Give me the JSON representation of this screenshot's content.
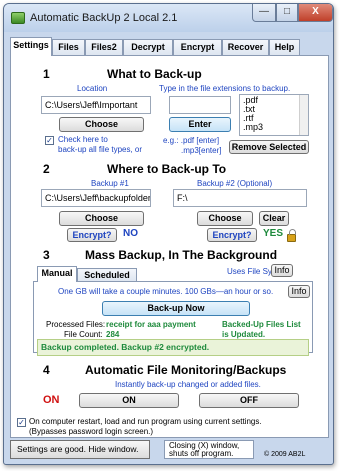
{
  "window": {
    "title": "Automatic BackUp 2 Local 2.1",
    "min_glyph": "—",
    "max_glyph": "□",
    "close_glyph": "X"
  },
  "tabs": [
    "Settings",
    "Files",
    "Files2",
    "Decrypt",
    "Encrypt",
    "Recover",
    "Help"
  ],
  "section1": {
    "num": "1",
    "title": "What to Back-up",
    "location_label": "Location",
    "location_value": "C:\\Users\\Jeff\\Important",
    "choose_label": "Choose",
    "ext_hint": "Type in the file extensions to backup.",
    "ext_input": "",
    "enter_label": "Enter",
    "examples_line1": "e.g.: .pdf [enter]",
    "examples_line2": ".mp3[enter]",
    "extensions": [
      ".pdf",
      ".txt",
      ".rtf",
      ".mp3"
    ],
    "remove_label": "Remove Selected",
    "checkbox_checked": true,
    "checkbox_line1": "Check here to",
    "checkbox_line2": "back-up all file types, or"
  },
  "section2": {
    "num": "2",
    "title": "Where to Back-up To",
    "backup1_label": "Backup #1",
    "backup1_value": "C:\\Users\\Jeff\\backupfolder2",
    "backup2_label": "Backup #2 (Optional)",
    "backup2_value": "F:\\",
    "choose1_label": "Choose",
    "choose2_label": "Choose",
    "clear_label": "Clear",
    "encrypt1_label": "Encrypt?",
    "encrypt1_state": "NO",
    "encrypt2_label": "Encrypt?",
    "encrypt2_state": "YES"
  },
  "section3": {
    "num": "3",
    "title": "Mass Backup, In The Background",
    "uses_file_syncing": "Uses File Syncing",
    "info_label": "Info",
    "inner_tabs": [
      "Manual",
      "Scheduled"
    ],
    "estimate": "One GB will take a couple minutes.  100 GBs—an hour or so.",
    "info2_label": "Info",
    "backup_now_label": "Back-up Now",
    "processed_label": "Processed Files:",
    "processed_value": "receipt for aaa payment",
    "count_label": "File Count:",
    "count_value": "284",
    "list_updated_line1": "Backed-Up Files List",
    "list_updated_line2": "is Updated.",
    "status": "Backup completed.  Backup #2 encrypted."
  },
  "section4": {
    "num": "4",
    "title": "Automatic File Monitoring/Backups",
    "subtitle": "Instantly back-up changed or added files.",
    "state": "ON",
    "on_label": "ON",
    "off_label": "OFF"
  },
  "bottom": {
    "restart_checked": true,
    "restart_line1": "On computer restart, load and run program using current settings.",
    "restart_line2": "(Bypasses password login screen.)",
    "settings_good": "Settings are good.  Hide window.",
    "close_note_line1": "Closing (X) window,",
    "close_note_line2": "shuts off program.",
    "copyright": "© 2009 AB2L"
  },
  "colors": {
    "accent_blue": "#1e44c0",
    "green": "#1e8a3c",
    "red": "#d01010",
    "window_bg": "#c8d7ec"
  }
}
